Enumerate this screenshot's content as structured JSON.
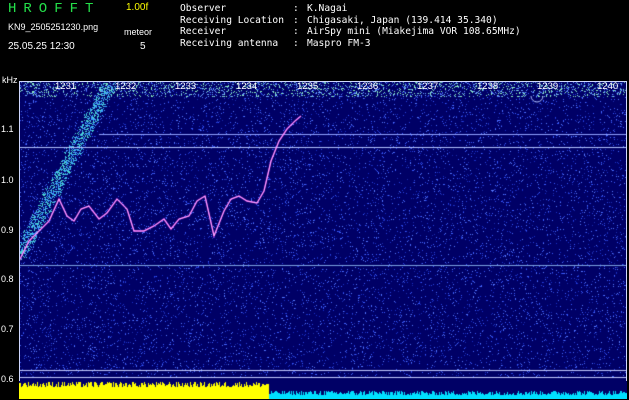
{
  "header": {
    "logo": "HROFFT",
    "version": "1.00f",
    "filename": "KN9_2505251230.png",
    "mode_label": "meteor",
    "datetime": "25.05.25 12:30",
    "mode_value": "5"
  },
  "info": [
    {
      "key": "Observer",
      "value": "K.Nagai"
    },
    {
      "key": "Receiving Location",
      "value": "Chigasaki, Japan (139.414 35.340)"
    },
    {
      "key": "Receiver",
      "value": "AirSpy mini (Miakejima VOR 108.65MHz)"
    },
    {
      "key": "Receiving antenna",
      "value": "Maspro FM-3"
    }
  ],
  "axis": {
    "unit": "kHz",
    "y_ticks": [
      "1.1",
      "1.0",
      "0.9",
      "0.8",
      "0.7",
      "0.6"
    ],
    "time_ticks": [
      "1231",
      "1232",
      "1233",
      "1234",
      "1235",
      "1236",
      "1237",
      "1238",
      "1239",
      "1240"
    ]
  },
  "colors": {
    "background": "#000066",
    "noise": "#3a5cff",
    "signal": "#ff40ff",
    "bottom_yellow": "#ffff00",
    "bottom_cyan": "#00e0ff",
    "header_green": "#24e04a"
  }
}
